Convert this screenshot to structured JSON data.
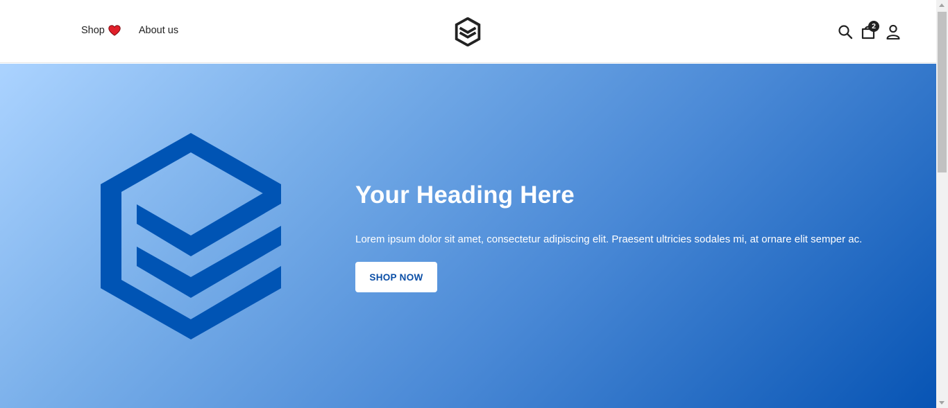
{
  "header": {
    "nav": [
      {
        "label": "Shop",
        "icon": "heart-icon"
      },
      {
        "label": "About us"
      }
    ],
    "logo_icon": "cube-logo-icon",
    "icons": [
      "search-icon",
      "shopping-bag-icon",
      "user-icon"
    ],
    "cart_count": "2"
  },
  "hero": {
    "title": "Your Heading Here",
    "text": "Lorem ipsum dolor sit amet, consectetur adipiscing elit. Praesent ultricies sodales mi, at ornare elit semper ac.",
    "button_label": "SHOP NOW",
    "logo_color": "#0054b4",
    "gradient_start": "#abd3ff",
    "gradient_end": "#0754b4"
  },
  "colors": {
    "heart": "#e0202a",
    "button_text": "#0a4ea6"
  }
}
